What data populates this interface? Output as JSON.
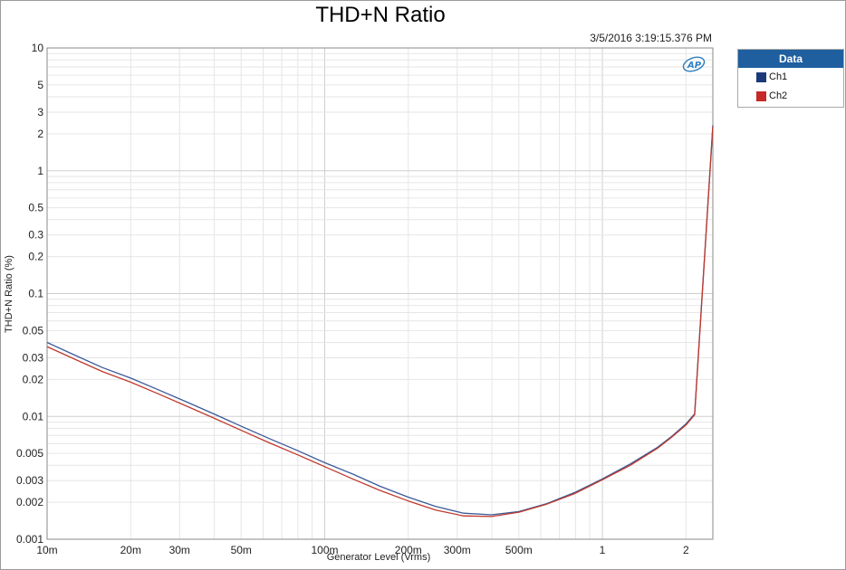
{
  "chart_data": {
    "type": "line",
    "title": "THD+N Ratio",
    "timestamp": "3/5/2016 3:19:15.376 PM",
    "xlabel": "Generator Level (Vrms)",
    "ylabel": "THD+N Ratio (%)",
    "xscale": "log",
    "yscale": "log",
    "xlim": [
      0.01,
      2.5
    ],
    "ylim": [
      0.001,
      10
    ],
    "grid": true,
    "legend_title": "Data",
    "legend_position": "right",
    "x_ticks": [
      {
        "value": 0.01,
        "label": "10m"
      },
      {
        "value": 0.02,
        "label": "20m"
      },
      {
        "value": 0.03,
        "label": "30m"
      },
      {
        "value": 0.05,
        "label": "50m"
      },
      {
        "value": 0.1,
        "label": "100m"
      },
      {
        "value": 0.2,
        "label": "200m"
      },
      {
        "value": 0.3,
        "label": "300m"
      },
      {
        "value": 0.5,
        "label": "500m"
      },
      {
        "value": 1,
        "label": "1"
      },
      {
        "value": 2,
        "label": "2"
      }
    ],
    "y_ticks": [
      {
        "value": 10,
        "label": "10"
      },
      {
        "value": 5,
        "label": "5"
      },
      {
        "value": 3,
        "label": "3"
      },
      {
        "value": 2,
        "label": "2"
      },
      {
        "value": 1,
        "label": "1"
      },
      {
        "value": 0.5,
        "label": "0.5"
      },
      {
        "value": 0.3,
        "label": "0.3"
      },
      {
        "value": 0.2,
        "label": "0.2"
      },
      {
        "value": 0.1,
        "label": "0.1"
      },
      {
        "value": 0.05,
        "label": "0.05"
      },
      {
        "value": 0.03,
        "label": "0.03"
      },
      {
        "value": 0.02,
        "label": "0.02"
      },
      {
        "value": 0.01,
        "label": "0.01"
      },
      {
        "value": 0.005,
        "label": "0.005"
      },
      {
        "value": 0.003,
        "label": "0.003"
      },
      {
        "value": 0.002,
        "label": "0.002"
      },
      {
        "value": 0.001,
        "label": "0.001"
      }
    ],
    "series": [
      {
        "name": "Ch1",
        "color": "#3b5a9a",
        "x": [
          0.01,
          0.0126,
          0.0158,
          0.02,
          0.0251,
          0.0316,
          0.0398,
          0.0501,
          0.0631,
          0.0794,
          0.1,
          0.126,
          0.158,
          0.2,
          0.251,
          0.316,
          0.398,
          0.501,
          0.631,
          0.794,
          1.0,
          1.26,
          1.58,
          1.78,
          2.0,
          2.15,
          2.5
        ],
        "y": [
          0.04,
          0.0315,
          0.025,
          0.0205,
          0.0165,
          0.0132,
          0.0105,
          0.0083,
          0.0066,
          0.0053,
          0.0042,
          0.0034,
          0.0027,
          0.0022,
          0.00185,
          0.00163,
          0.00158,
          0.00168,
          0.00195,
          0.0024,
          0.0031,
          0.0041,
          0.0056,
          0.0069,
          0.0087,
          0.0105,
          2.35
        ]
      },
      {
        "name": "Ch2",
        "color": "#c0392b",
        "x": [
          0.01,
          0.0126,
          0.0158,
          0.02,
          0.0251,
          0.0316,
          0.0398,
          0.0501,
          0.0631,
          0.0794,
          0.1,
          0.126,
          0.158,
          0.2,
          0.251,
          0.316,
          0.398,
          0.501,
          0.631,
          0.794,
          1.0,
          1.26,
          1.58,
          1.78,
          2.0,
          2.15,
          2.5
        ],
        "y": [
          0.037,
          0.0292,
          0.0232,
          0.019,
          0.0153,
          0.0122,
          0.0097,
          0.0077,
          0.0061,
          0.0049,
          0.0039,
          0.0031,
          0.0025,
          0.00205,
          0.00173,
          0.00155,
          0.00153,
          0.00166,
          0.00193,
          0.00235,
          0.00305,
          0.004,
          0.0055,
          0.0068,
          0.0085,
          0.0103,
          2.3
        ]
      }
    ]
  }
}
